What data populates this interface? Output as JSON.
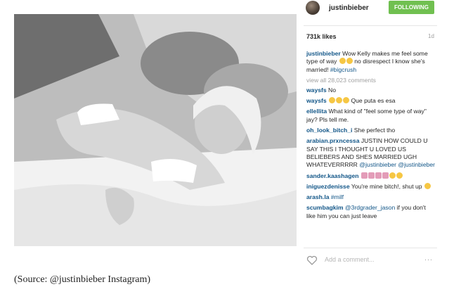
{
  "post": {
    "photo_alt": "post-photo",
    "username": "justinbieber",
    "follow_label": "FOLLOWING",
    "likes": "731k likes",
    "age": "1d",
    "caption": {
      "user": "justinbieber",
      "text": " Wow Kelly makes me feel some type of way ",
      "text2": " no disrespect I know she's married! ",
      "hashtag": "#bigcrush"
    },
    "view_all": "view all 28,023 comments",
    "comments": [
      {
        "user": "waysfs",
        "text": " No"
      },
      {
        "user": "waysfs",
        "text": " Que puta es esa"
      },
      {
        "user": "ellellita",
        "text": " What kind of \"feel some type of way\" jay? Pls tell me."
      },
      {
        "user": "oh_look_bitch_i",
        "text": " She perfect tho"
      },
      {
        "user": "arabian.prxncessa",
        "text": " JUSTIN HOW COULD U SAY THIS I THOUGHT U LOVED US BELIEBERS AND SHES MARRIED UGH WHATEVERRRRR ",
        "mention": "@justinbieber @justinbieber"
      },
      {
        "user": "sander.kaashagen",
        "text": " "
      },
      {
        "user": "iniguezdenisse",
        "text": " You're mine bitch!, shut up "
      },
      {
        "user": "arash.la",
        "text": " ",
        "hashtag": "#milf"
      },
      {
        "user": "scumbagkim",
        "mention": " @3rdgrader_jason",
        "text": " if you don't like him you can just leave"
      }
    ],
    "add_comment_placeholder": "Add a comment...",
    "more": "···"
  },
  "source": "(Source: @justinbieber Instagram)"
}
